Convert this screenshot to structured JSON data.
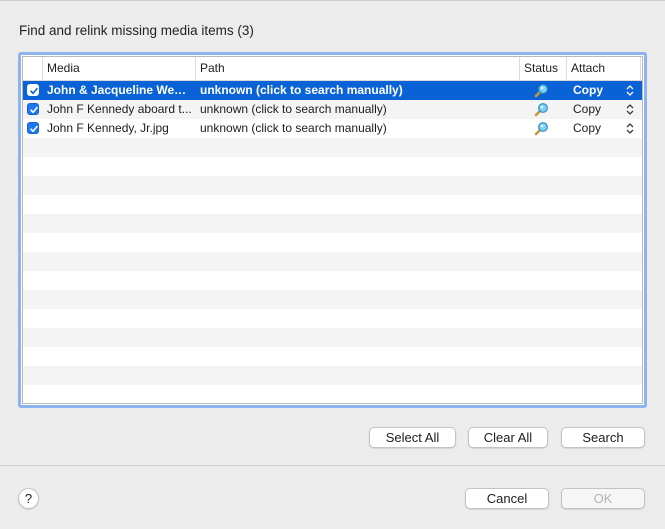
{
  "dialog": {
    "title": "Find and relink missing media items (3)"
  },
  "table": {
    "columns": {
      "media": "Media",
      "path": "Path",
      "status": "Status",
      "attach": "Attach"
    },
    "rows": [
      {
        "checked": true,
        "media": "John & Jacqueline Weddi...",
        "path": "unknown (click to search manually)",
        "status_icon": "magnifier-icon",
        "attach": "Copy",
        "selected": true
      },
      {
        "checked": true,
        "media": "John F Kennedy aboard t...",
        "path": "unknown (click to search manually)",
        "status_icon": "magnifier-icon",
        "attach": "Copy",
        "selected": false
      },
      {
        "checked": true,
        "media": "John F Kennedy, Jr.jpg",
        "path": "unknown (click to search manually)",
        "status_icon": "magnifier-icon",
        "attach": "Copy",
        "selected": false
      }
    ]
  },
  "buttons": {
    "select_all": "Select All",
    "clear_all": "Clear All",
    "search": "Search",
    "cancel": "Cancel",
    "ok": "OK",
    "help": "?"
  },
  "colors": {
    "selection": "#0a63d6",
    "focus_ring": "#8cb4ee",
    "checkbox": "#1b78f0"
  }
}
